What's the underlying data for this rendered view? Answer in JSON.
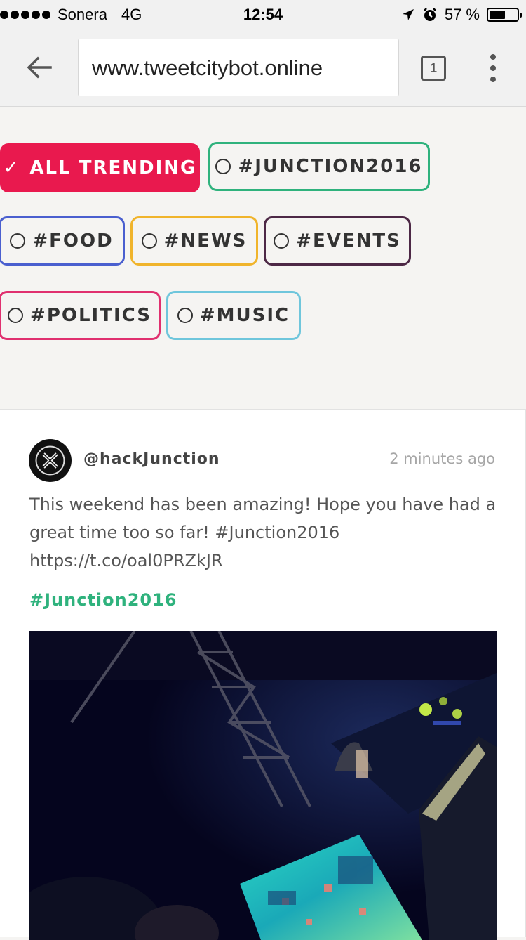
{
  "status_bar": {
    "carrier": "Sonera",
    "network": "4G",
    "time": "12:54",
    "battery_percent_label": "57 %",
    "battery_level": 0.57
  },
  "browser": {
    "url": "www.tweetcitybot.online",
    "tab_count": "1"
  },
  "filters": [
    {
      "label": "ALL TRENDING",
      "active": true,
      "color": "#e9194e"
    },
    {
      "label": "#JUNCTION2016",
      "active": false,
      "color": "#2fb27d"
    },
    {
      "label": "#FOOD",
      "active": false,
      "color": "#4a5fcf"
    },
    {
      "label": "#NEWS",
      "active": false,
      "color": "#f0b42c"
    },
    {
      "label": "#EVENTS",
      "active": false,
      "color": "#4d2846"
    },
    {
      "label": "#POLITICS",
      "active": false,
      "color": "#e0306f"
    },
    {
      "label": "#MUSIC",
      "active": false,
      "color": "#6fc6dc"
    }
  ],
  "tweet": {
    "handle": "@hackJunction",
    "time_ago": "2 minutes ago",
    "text": "This weekend has been amazing! Hope you have had a great time too so far! #Junction2016 https://t.co/oal0PRZkJR",
    "hashtag": "#Junction2016"
  }
}
